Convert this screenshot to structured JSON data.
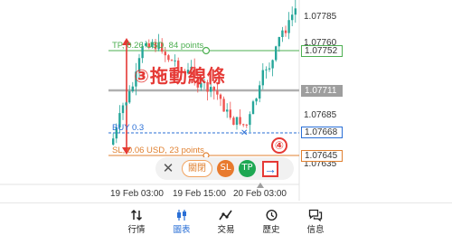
{
  "annotation": {
    "title": "③拖動線條",
    "step_number": "④"
  },
  "price_axis": {
    "ticks": [
      "1.07785",
      "1.07760",
      "1.07685",
      "1.07635"
    ],
    "tp_price": "1.07752",
    "current_price": "1.07711",
    "entry_price": "1.07668",
    "sl_price": "1.07645"
  },
  "order_lines": {
    "tp_label": "TP, 0.26 USD, 84 points",
    "buy_label": "BUY 0.3",
    "sl_label": "SL, 0.06 USD, 23 points"
  },
  "order_bar": {
    "close_label": "關閉",
    "sl_label": "SL",
    "tp_label": "TP"
  },
  "time_axis": {
    "labels": [
      "19 Feb 03:00",
      "19 Feb 15:00",
      "20 Feb 03:00"
    ]
  },
  "bottom_nav": {
    "items": [
      {
        "label": "行情",
        "icon": "arrows-updown-icon"
      },
      {
        "label": "圖表",
        "icon": "candlestick-icon"
      },
      {
        "label": "交易",
        "icon": "trend-line-icon"
      },
      {
        "label": "歷史",
        "icon": "history-icon"
      },
      {
        "label": "信息",
        "icon": "chat-icon"
      }
    ],
    "active_index": 1
  },
  "colors": {
    "tp_line": "#4caf50",
    "sl_line": "#e08030",
    "buy_line": "#2a6fd6",
    "accent": "#2a6fd6",
    "annotation": "#e53935",
    "bull": "#26a69a",
    "bear": "#ef5350"
  }
}
